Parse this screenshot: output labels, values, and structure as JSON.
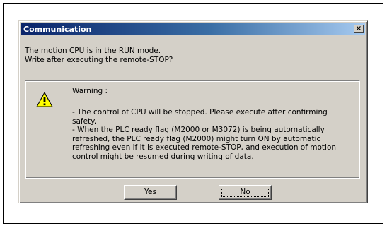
{
  "window": {
    "title": "Communication",
    "close_glyph": "×",
    "colors": {
      "titlebar_start": "#0a246a",
      "titlebar_end": "#a6caf0",
      "face": "#d4d0c8",
      "title_text": "#ffffff"
    }
  },
  "message": {
    "line1": "The motion CPU is in the RUN mode.",
    "line2": "Write after executing the remote-STOP?"
  },
  "warning": {
    "icon": "warning-triangle-icon",
    "title": "Warning :",
    "lines": [
      "- The control of CPU will be stopped. Please execute after confirming",
      "safety.",
      "- When the PLC ready flag (M2000 or M3072) is being automatically",
      "refreshed, the PLC ready flag (M2000) might turn ON by automatic",
      "refreshing even if it is executed remote-STOP, and execution of motion",
      "control might be resumed during writing of data."
    ]
  },
  "buttons": {
    "yes_label": "Yes",
    "no_label": "No"
  }
}
